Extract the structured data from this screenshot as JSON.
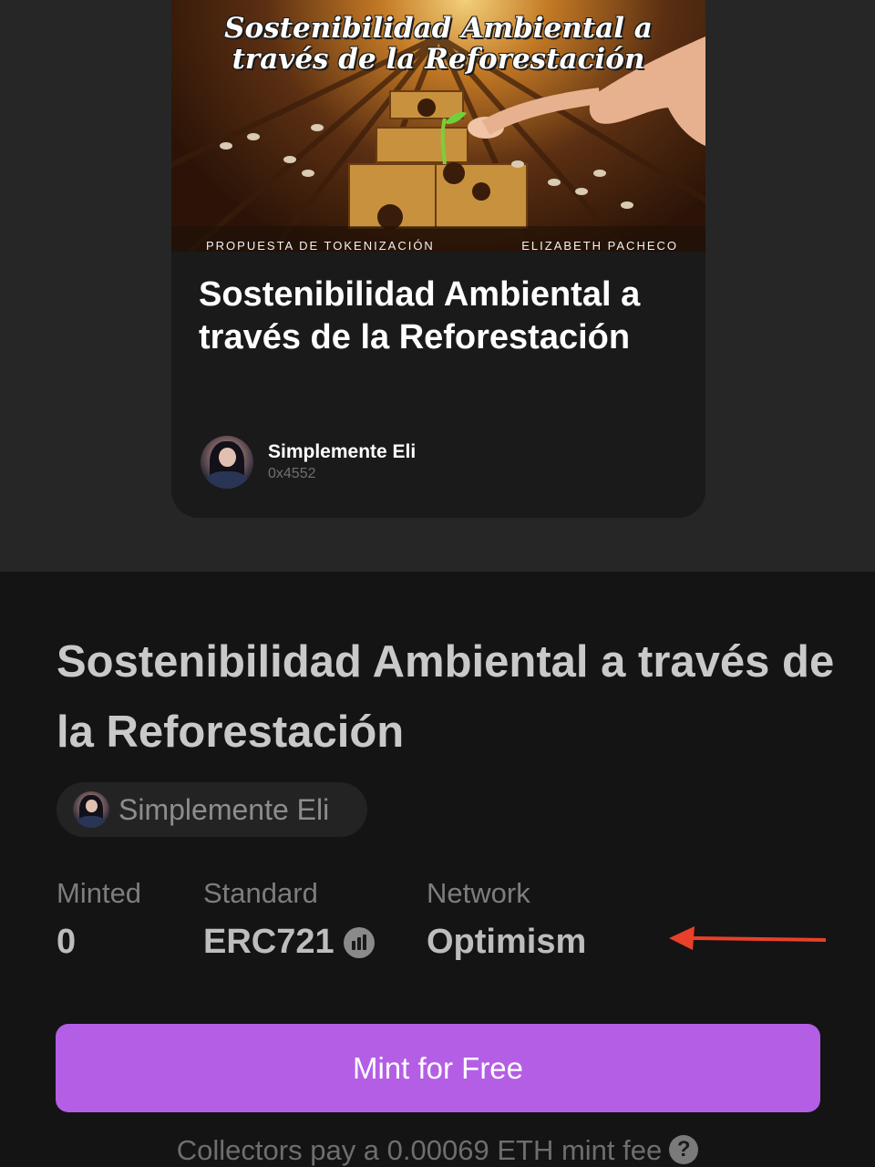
{
  "card": {
    "cover_title": "Sostenibilidad Ambiental a través de la Reforestación",
    "cover_footer_left": "PROPUESTA DE TOKENIZACIÓN",
    "cover_footer_right": "ELIZABETH PACHECO",
    "title": "Sostenibilidad Ambiental a través de la Reforestación",
    "author_name": "Simplemente Eli",
    "author_address": "0x4552"
  },
  "details": {
    "title": "Sostenibilidad Ambiental a través de la Reforestación",
    "creator": "Simplemente Eli",
    "stats": {
      "minted_label": "Minted",
      "minted_value": "0",
      "standard_label": "Standard",
      "standard_value": "ERC721",
      "network_label": "Network",
      "network_value": "Optimism"
    }
  },
  "mint_button_label": "Mint for Free",
  "fee_note": "Collectors pay a 0.00069 ETH mint fee",
  "help_icon_glyph": "?",
  "colors": {
    "accent": "#b45ee6",
    "annotation_arrow": "#e8402a"
  },
  "icons": [
    "help-icon",
    "etherscan-icon",
    "annotation-arrow"
  ]
}
